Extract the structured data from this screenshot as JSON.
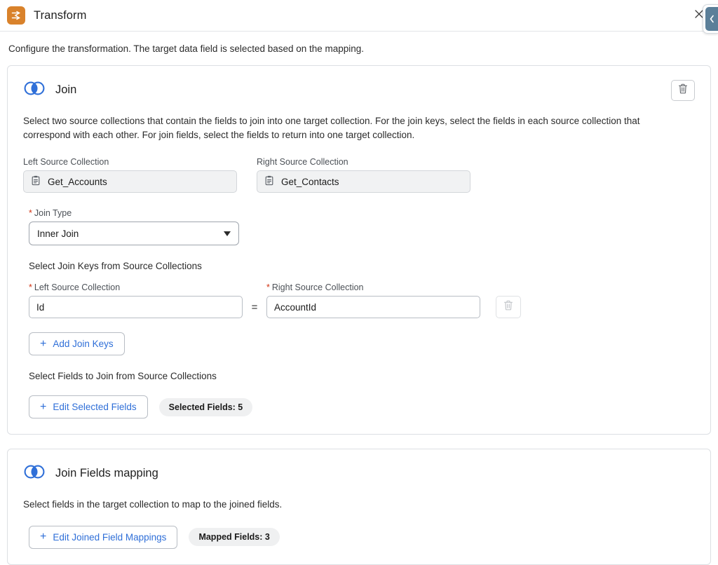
{
  "header": {
    "title": "Transform",
    "app_icon": "transform-icon",
    "close_icon": "close-icon",
    "edge_tab_icon": "chevron-left-icon"
  },
  "intro": "Configure the transformation. The target data field is selected based on the mapping.",
  "join_card": {
    "title": "Join",
    "icon": "venn-join-icon",
    "delete_icon": "trash-icon",
    "description": "Select two source collections that contain the fields to join into one target collection. For the join keys, select the fields in each source collection that correspond with each other. For join fields, select the fields to return into one target collection.",
    "left_source": {
      "label": "Left Source Collection",
      "value": "Get_Accounts",
      "icon": "clipboard-icon"
    },
    "right_source": {
      "label": "Right Source Collection",
      "value": "Get_Contacts",
      "icon": "clipboard-icon"
    },
    "join_type": {
      "label": "Join Type",
      "required_marker": "*",
      "value": "Inner Join",
      "caret_icon": "chevron-down-icon"
    },
    "join_keys_heading": "Select Join Keys from Source Collections",
    "join_key_row": {
      "left_label": "Left Source Collection",
      "left_value": "Id",
      "equals": "=",
      "right_label": "Right Source Collection",
      "right_value": "AccountId",
      "required_marker": "*",
      "delete_icon": "trash-icon"
    },
    "add_join_keys_label": "Add Join Keys",
    "add_icon": "plus-icon",
    "fields_heading": "Select Fields to Join from Source Collections",
    "edit_selected_fields_label": "Edit Selected Fields",
    "selected_fields_badge": "Selected Fields: 5"
  },
  "mapping_card": {
    "title": "Join Fields mapping",
    "icon": "venn-join-icon",
    "description": "Select fields in the target collection to map to the joined fields.",
    "edit_mappings_label": "Edit Joined Field Mappings",
    "mapped_fields_badge": "Mapped Fields: 3",
    "add_icon": "plus-icon"
  },
  "colors": {
    "accent_blue": "#2f6fd8",
    "brand_orange": "#d9822b",
    "required_red": "#d13212",
    "border_grey": "#dcdfe3"
  }
}
